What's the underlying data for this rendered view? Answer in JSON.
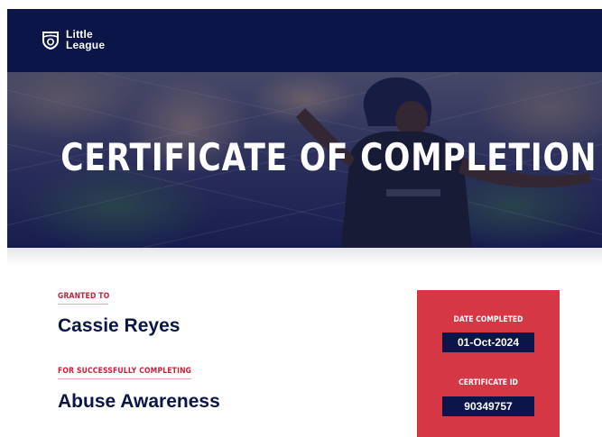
{
  "brand": {
    "line1": "Little",
    "line2": "League"
  },
  "banner": {
    "title": "CERTIFICATE OF COMPLETION"
  },
  "recipient": {
    "label": "GRANTED TO",
    "name": "Cassie Reyes"
  },
  "course": {
    "label": "FOR SUCCESSFULLY COMPLETING",
    "name": "Abuse Awareness"
  },
  "details": {
    "date_label": "DATE COMPLETED",
    "date_value": "01-Oct-2024",
    "id_label": "CERTIFICATE ID",
    "id_value": "90349757"
  },
  "colors": {
    "navy": "#0b1548",
    "red": "#d63744",
    "label_red": "#c8203a"
  }
}
